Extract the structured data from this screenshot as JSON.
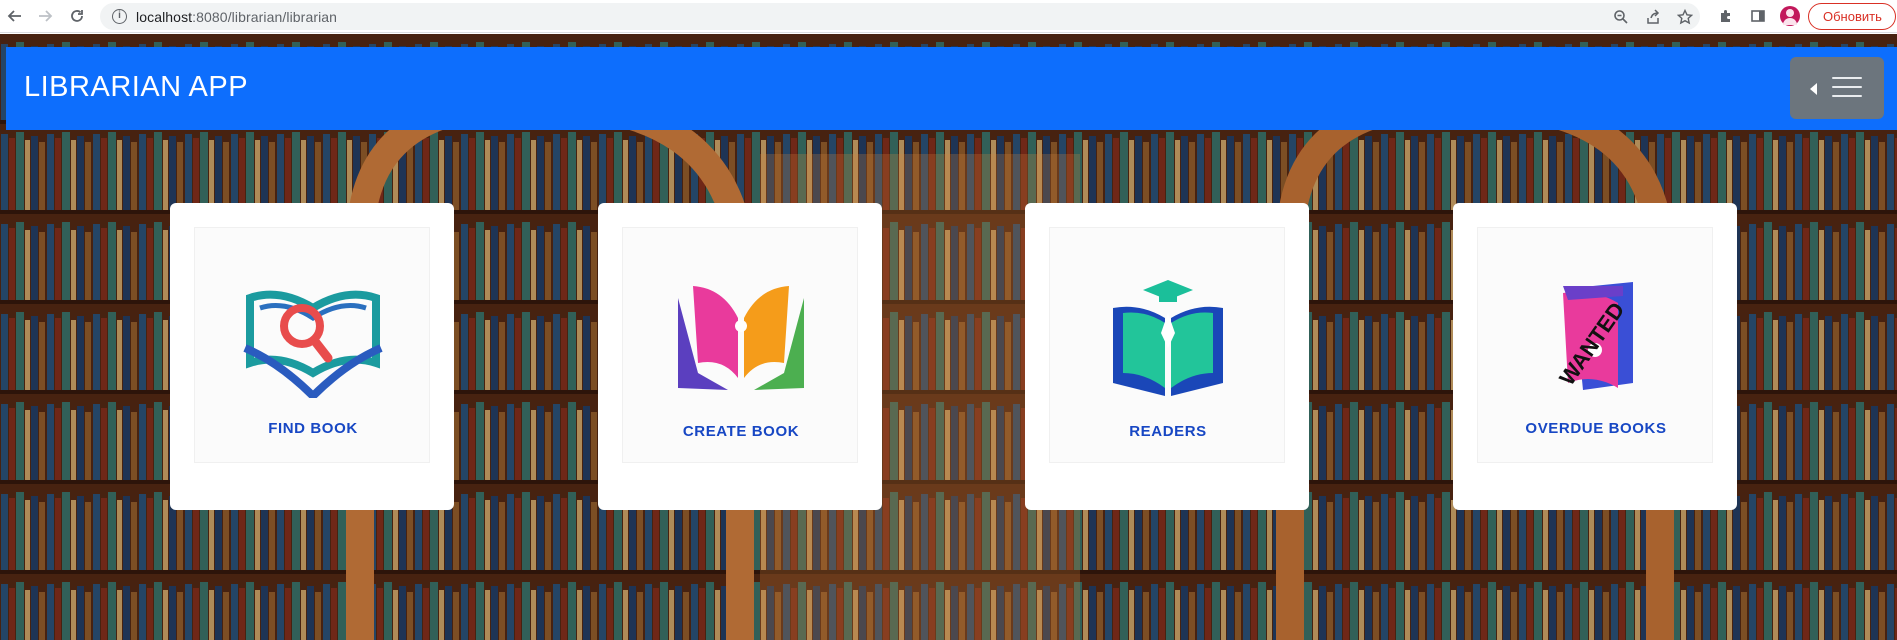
{
  "browser": {
    "url_host": "localhost",
    "url_rest": ":8080/librarian/librarian",
    "update_label": "Обновить",
    "icons": [
      "back-icon",
      "forward-icon",
      "reload-icon",
      "info-icon",
      "zoom-icon",
      "share-icon",
      "star-icon",
      "extensions-icon",
      "sidepanel-icon",
      "profile-avatar"
    ]
  },
  "navbar": {
    "brand": "LIBRARIAN APP",
    "color": "#0d6efd",
    "toggler_color": "#6c757d"
  },
  "cards": [
    {
      "label": "FIND BOOK",
      "icon": "open-book-magnifier-icon"
    },
    {
      "label": "CREATE BOOK",
      "icon": "colorful-open-book-icon"
    },
    {
      "label": "READERS",
      "icon": "graduate-book-icon"
    },
    {
      "label": "OVERDUE BOOKS",
      "icon": "wanted-book-icon",
      "stamp": "WANTED"
    }
  ],
  "colors": {
    "card_label": "#1747c4"
  }
}
